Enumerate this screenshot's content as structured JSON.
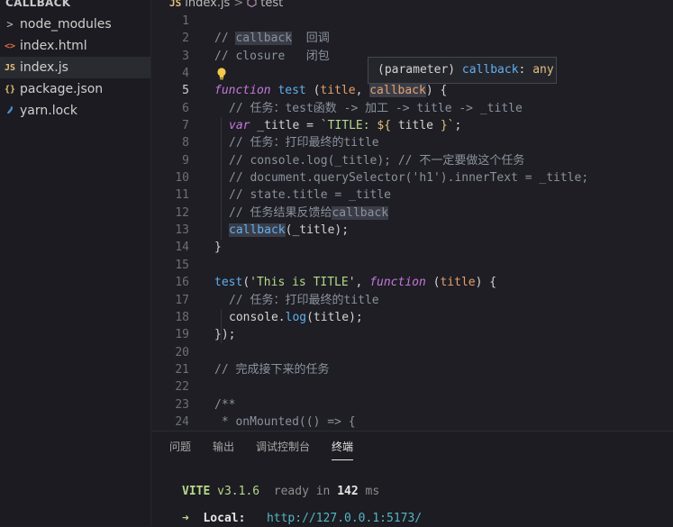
{
  "sidebar": {
    "title": "CALLBACK",
    "items": [
      {
        "icon": ">",
        "label": "node_modules",
        "color": "#bbbbbb"
      },
      {
        "icon": "<>",
        "label": "index.html",
        "color": "#e06c4b"
      },
      {
        "icon": "JS",
        "label": "index.js",
        "color": "#e5c07b"
      },
      {
        "icon": "{}",
        "label": "package.json",
        "color": "#e5c07b"
      },
      {
        "icon": "yarn",
        "label": "yarn.lock",
        "color": "#4a90c9"
      }
    ]
  },
  "breadcrumb": {
    "lang": "JS",
    "file": "index.js",
    "sep": ">",
    "symbol": "test"
  },
  "tooltip": {
    "kind": "(parameter)",
    "name": "callback",
    "type": "any"
  },
  "editor": {
    "current_line": 5,
    "lines": [
      "1",
      "2",
      "3",
      "4",
      "5",
      "6",
      "7",
      "8",
      "9",
      "10",
      "11",
      "12",
      "13",
      "14",
      "15",
      "16",
      "17",
      "18",
      "19",
      "20",
      "21",
      "22",
      "23",
      "24"
    ],
    "code": {
      "l2_a": "// ",
      "l2_b": "callback",
      "l2_c": "  回调",
      "l3": "// closure   闭包",
      "l5_kw": "function",
      "l5_fn": "test",
      "l5_a": " (",
      "l5_p1": "title",
      "l5_b": ", ",
      "l5_p2": "callback",
      "l5_c": ") {",
      "l6": "// 任务：test函数 -> 加工 -> title -> _title",
      "l7_kw": "var",
      "l7_a": " _title = ",
      "l7_s1": "`TITLE: ",
      "l7_t1": "${",
      "l7_v": " title ",
      "l7_t2": "}",
      "l7_s2": "`",
      "l7_b": ";",
      "l8": "// 任务：打印最终的title",
      "l9": "// console.log(_title); // 不一定要做这个任务",
      "l10": "// document.querySelector('h1').innerText = _title;",
      "l11": "// state.title = _title",
      "l12_a": "// 任务结果反馈给",
      "l12_b": "callback",
      "l13_fn": "callback",
      "l13_a": "(_title);",
      "l14": "}",
      "l16_fn": "test",
      "l16_a": "(",
      "l16_s": "'This is TITLE'",
      "l16_b": ", ",
      "l16_kw": "function",
      "l16_c": " (",
      "l16_p": "title",
      "l16_d": ") {",
      "l17": "// 任务：打印最终的title",
      "l18_a": "console.",
      "l18_fn": "log",
      "l18_b": "(title);",
      "l19": "});",
      "l21": "// 完成接下来的任务",
      "l23": "/**",
      "l24": " * onMounted(() => {"
    }
  },
  "panel": {
    "tabs": [
      {
        "label": "问题",
        "active": false
      },
      {
        "label": "输出",
        "active": false
      },
      {
        "label": "调试控制台",
        "active": false
      },
      {
        "label": "终端",
        "active": true
      }
    ],
    "terminal": {
      "vite": "VITE",
      "version": "v3.1.6",
      "ready": "ready in",
      "time": "142",
      "ms": "ms",
      "arrow": "➜",
      "local_label": "Local:",
      "local_url": "http://127.0.0.1:5173/"
    }
  }
}
